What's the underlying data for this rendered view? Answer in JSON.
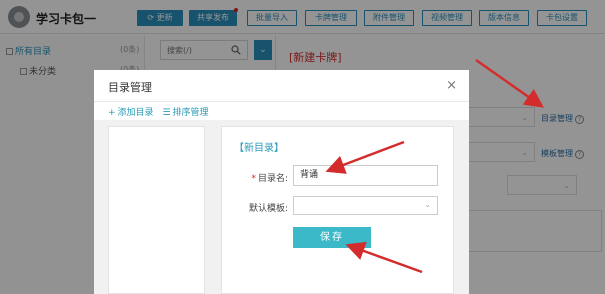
{
  "app": {
    "title": "学习卡包一",
    "toolbar": [
      {
        "label": "更新",
        "primary": true,
        "icon": "refresh-icon"
      },
      {
        "label": "共享发布",
        "primary": true,
        "dot": true
      },
      {
        "label": "批量导入",
        "primary": false
      },
      {
        "label": "卡牌管理",
        "primary": false
      },
      {
        "label": "附件管理",
        "primary": false
      },
      {
        "label": "视频管理",
        "primary": false
      },
      {
        "label": "版本信息",
        "primary": false
      },
      {
        "label": "卡包设置",
        "primary": false
      }
    ]
  },
  "sidebar": {
    "root_label": "所有目录",
    "root_count": "(0条)",
    "child_label": "未分类",
    "child_count": "(0条)"
  },
  "search": {
    "placeholder": "搜索(/)"
  },
  "editor": {
    "title": "[新建卡牌]",
    "dir_link": "目录管理",
    "tpl_link": "模板管理",
    "help": "?"
  },
  "modal": {
    "title": "目录管理",
    "close": "×",
    "add_label": "添加目录",
    "sort_label": "排序管理",
    "form_heading": "【新目录】",
    "name_label": "目录名:",
    "name_value": "背诵",
    "template_label": "默认模板:",
    "template_value": "",
    "save_label": "保存"
  },
  "colors": {
    "accent": "#2a8fbd",
    "save": "#3cb9c9",
    "arrow": "#d42c2c"
  }
}
